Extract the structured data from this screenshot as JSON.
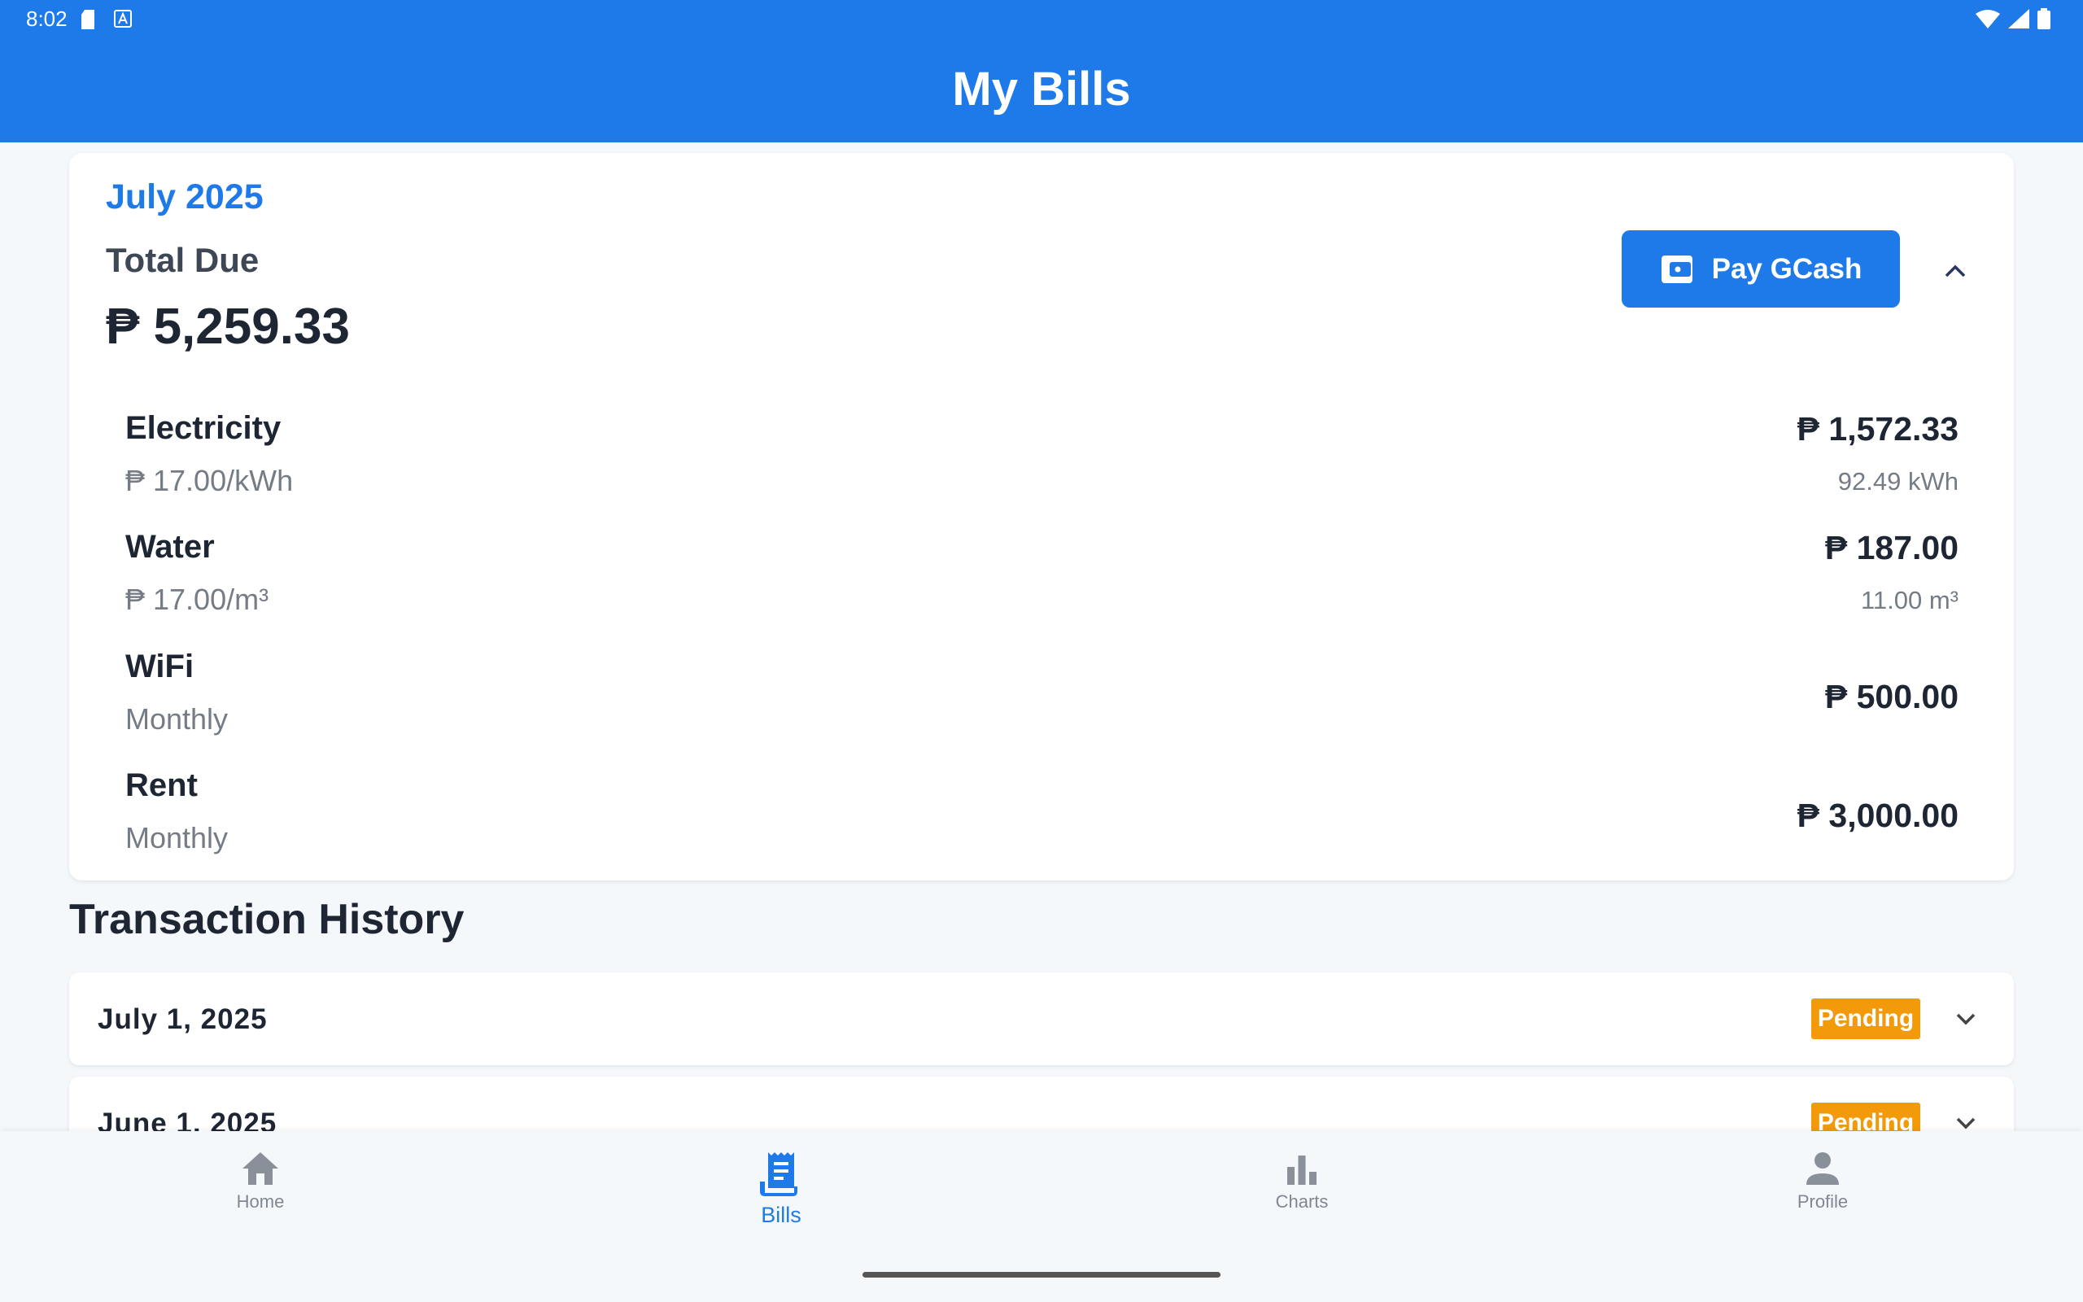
{
  "status_bar": {
    "time": "8:02"
  },
  "header": {
    "title": "My Bills"
  },
  "bill": {
    "month": "July 2025",
    "total_label": "Total Due",
    "total_amount": "₱ 5,259.33",
    "pay_label": "Pay GCash",
    "items": [
      {
        "name": "Electricity",
        "sub": "₱ 17.00/kWh",
        "amount": "₱ 1,572.33",
        "qty": "92.49 kWh"
      },
      {
        "name": "Water",
        "sub": "₱ 17.00/m³",
        "amount": "₱ 187.00",
        "qty": "11.00 m³"
      },
      {
        "name": "WiFi",
        "sub": "Monthly",
        "amount": "₱ 500.00",
        "qty": ""
      },
      {
        "name": "Rent",
        "sub": "Monthly",
        "amount": "₱ 3,000.00",
        "qty": ""
      }
    ]
  },
  "history": {
    "title": "Transaction History",
    "rows": [
      {
        "date": "July 1, 2025",
        "status": "Pending"
      },
      {
        "date": "June 1, 2025",
        "status": "Pending"
      }
    ]
  },
  "nav": {
    "items": [
      {
        "label": "Home",
        "icon": "home-icon"
      },
      {
        "label": "Bills",
        "icon": "receipt-icon"
      },
      {
        "label": "Charts",
        "icon": "bar-chart-icon"
      },
      {
        "label": "Profile",
        "icon": "person-icon"
      }
    ],
    "active": "Bills"
  },
  "colors": {
    "primary": "#1f7ae9",
    "pending": "#f39a0b"
  }
}
